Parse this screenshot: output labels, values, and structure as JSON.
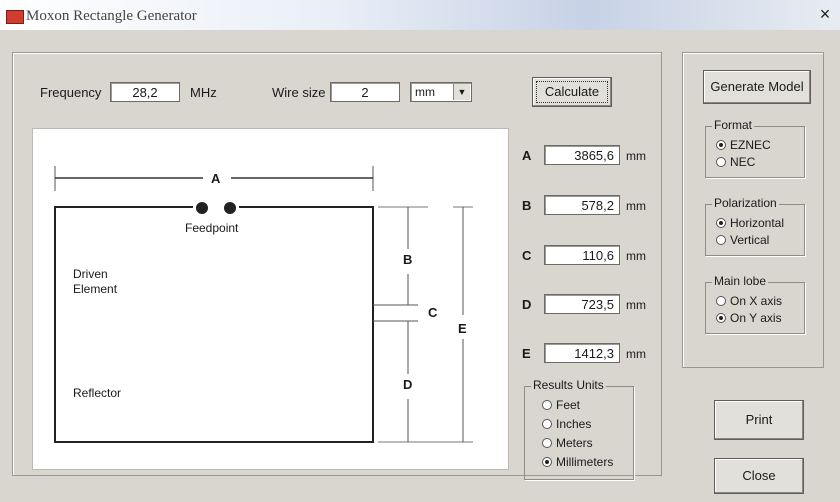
{
  "window": {
    "title": "Moxon Rectangle Generator",
    "close_glyph": "×"
  },
  "inputs": {
    "frequency_label": "Frequency",
    "frequency_value": "28,2",
    "frequency_unit": "MHz",
    "wire_size_label": "Wire size",
    "wire_size_value": "2",
    "wire_unit_selected": "mm"
  },
  "buttons": {
    "calculate": "Calculate",
    "generate_model": "Generate Model",
    "print": "Print",
    "close": "Close"
  },
  "results": [
    {
      "letter": "A",
      "value": "3865,6",
      "unit": "mm"
    },
    {
      "letter": "B",
      "value": "578,2",
      "unit": "mm"
    },
    {
      "letter": "C",
      "value": "110,6",
      "unit": "mm"
    },
    {
      "letter": "D",
      "value": "723,5",
      "unit": "mm"
    },
    {
      "letter": "E",
      "value": "1412,3",
      "unit": "mm"
    }
  ],
  "results_units": {
    "title": "Results Units",
    "options": [
      "Feet",
      "Inches",
      "Meters",
      "Millimeters"
    ],
    "selected": "Millimeters"
  },
  "format": {
    "title": "Format",
    "options": [
      "EZNEC",
      "NEC"
    ],
    "selected": "EZNEC"
  },
  "polarization": {
    "title": "Polarization",
    "options": [
      "Horizontal",
      "Vertical"
    ],
    "selected": "Horizontal"
  },
  "main_lobe": {
    "title": "Main lobe",
    "options": [
      "On X axis",
      "On Y axis"
    ],
    "selected": "On Y axis"
  },
  "diagram": {
    "dim_a": "A",
    "dim_b": "B",
    "dim_c": "C",
    "dim_d": "D",
    "dim_e": "E",
    "feedpoint": "Feedpoint",
    "driven_line1": "Driven",
    "driven_line2": "Element",
    "reflector": "Reflector"
  }
}
